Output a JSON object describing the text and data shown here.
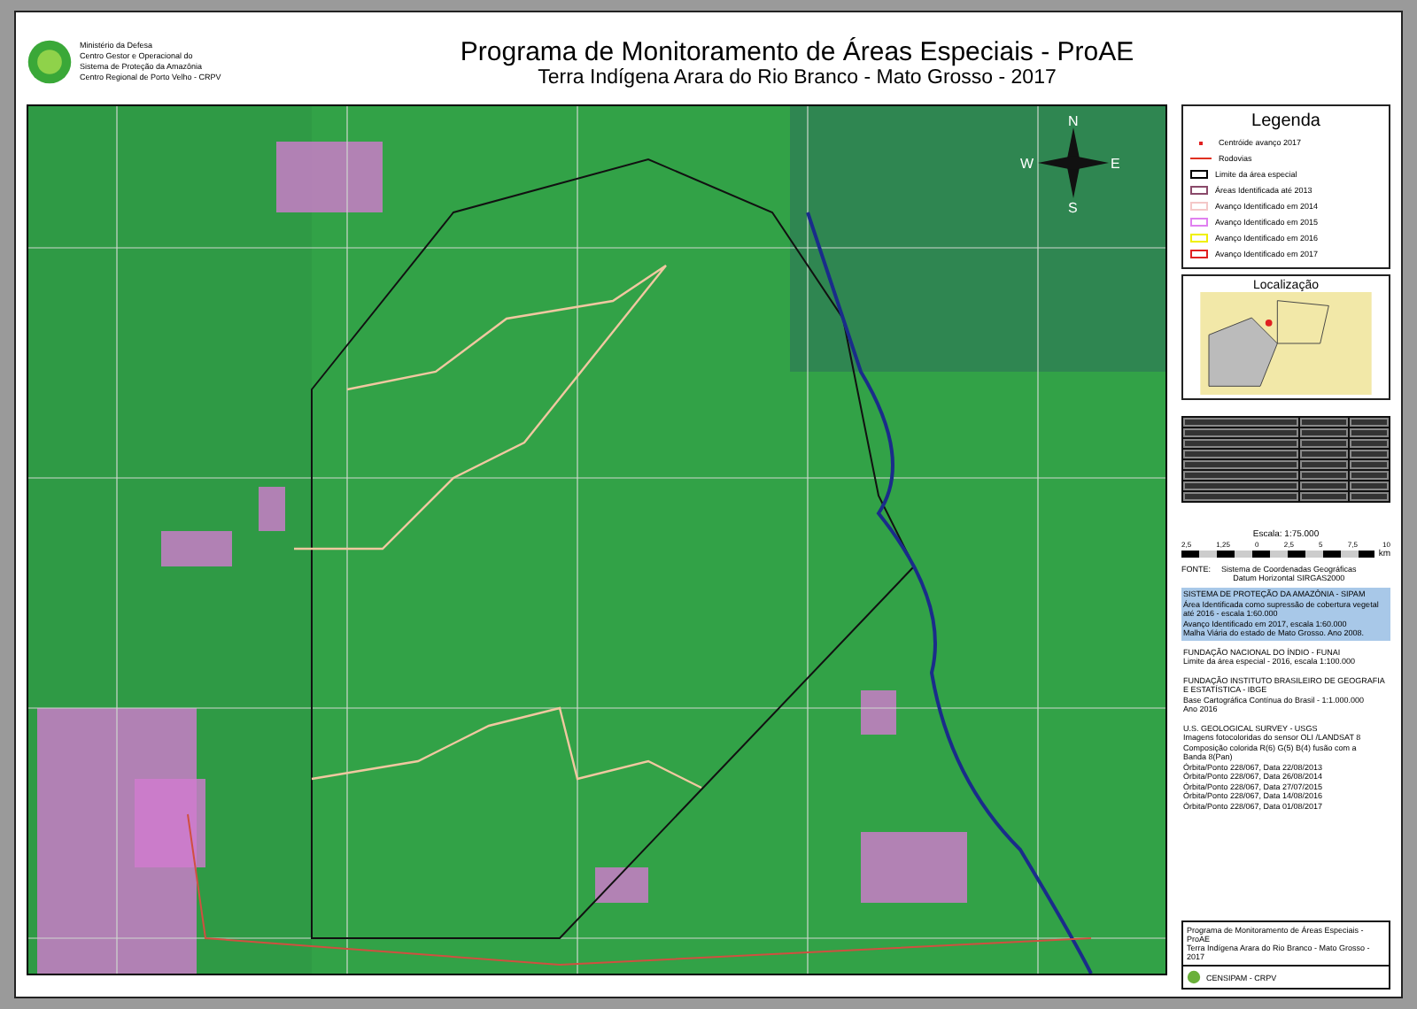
{
  "header": {
    "org_lines": [
      "Ministério da Defesa",
      "Centro Gestor e Operacional do",
      "Sistema de Proteção da Amazônia",
      "Centro Regional de Porto Velho - CRPV"
    ],
    "title": "Programa de Monitoramento de Áreas Especiais - ProAE",
    "subtitle": "Terra Indígena Arara do Rio Branco - Mato Grosso - 2017"
  },
  "compass": [
    "N",
    "W",
    "E",
    "S"
  ],
  "legend": {
    "title": "Legenda",
    "items": [
      {
        "kind": "point",
        "label": "Centróide avanço 2017",
        "color": "#e02020"
      },
      {
        "kind": "line",
        "label": "Rodovias",
        "color": "#e03020"
      },
      {
        "kind": "box",
        "label": "Limite da área especial",
        "color": "#000000"
      },
      {
        "kind": "box",
        "label": "Áreas Identificada até 2013",
        "color": "#8a4a6a"
      },
      {
        "kind": "box",
        "label": "Avanço Identificado em 2014",
        "color": "#f4c8c8"
      },
      {
        "kind": "box",
        "label": "Avanço Identificado em 2015",
        "color": "#e080f0"
      },
      {
        "kind": "box",
        "label": "Avanço Identificado em 2016",
        "color": "#f0f000"
      },
      {
        "kind": "box",
        "label": "Avanço Identificado em 2017",
        "color": "#e02020"
      }
    ]
  },
  "location": {
    "title": "Localização"
  },
  "scale": {
    "label": "Escala: 1:75.000",
    "ticks": [
      "2,5",
      "1,25",
      "0",
      "2,5",
      "5",
      "7,5",
      "10"
    ],
    "unit": "km"
  },
  "datum": {
    "source_label": "FONTE:",
    "lines": [
      "Sistema de Coordenadas Geográficas",
      "Datum Horizontal SIRGAS2000"
    ]
  },
  "sources": [
    {
      "highlighted": true,
      "lines": [
        "SISTEMA DE PROTEÇÃO DA AMAZÔNIA - SIPAM",
        "Área Identificada como supressão de cobertura vegetal até 2016 - escala 1:60.000",
        "Avanço Identificado em 2017, escala 1:60.000",
        "Malha Viária do estado de Mato Grosso. Ano 2008."
      ]
    },
    {
      "highlighted": false,
      "lines": [
        "FUNDAÇÃO NACIONAL DO ÍNDIO - FUNAI",
        "Limite da área especial - 2016, escala 1:100.000"
      ]
    },
    {
      "highlighted": false,
      "lines": [
        "FUNDAÇÃO INSTITUTO BRASILEIRO DE GEOGRAFIA E ESTATÍSTICA - IBGE",
        "Base Cartográfica Contínua do Brasil - 1:1.000.000",
        "Ano 2016"
      ]
    },
    {
      "highlighted": false,
      "lines": [
        "U.S. GEOLOGICAL SURVEY - USGS",
        "Imagens fotocoloridas do sensor OLI /LANDSAT 8",
        "Composição colorida R(6) G(5) B(4) fusão com a",
        "Banda 8(Pan)",
        "Órbita/Ponto 228/067, Data 22/08/2013",
        "Órbita/Ponto 228/067, Data 26/08/2014",
        "Órbita/Ponto 228/067, Data 27/07/2015",
        "Órbita/Ponto 228/067, Data 14/08/2016",
        "Órbita/Ponto 228/067, Data 01/08/2017"
      ]
    }
  ],
  "footer": {
    "title": "Programa de Monitoramento de Áreas Especiais - ProAE",
    "subtitle": "Terra Indígena Arara do Rio Branco - Mato Grosso - 2017",
    "org": "CENSIPAM - CRPV"
  }
}
